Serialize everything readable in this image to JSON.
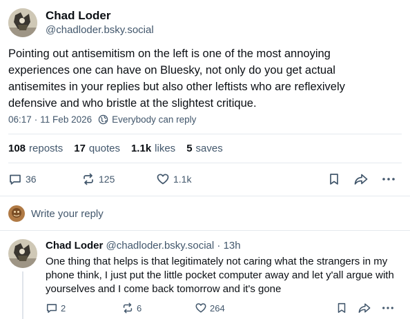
{
  "post": {
    "author_name": "Chad Loder",
    "author_handle": "@chadloder.bsky.social",
    "text": "Pointing out antisemitism on the left is one of the most annoying experiences one can have on Bluesky, not only do you get actual antisemites in your replies but also other leftists who are reflexively defensive and who bristle at the slightest critique.",
    "time": "06:17",
    "date": "11 Feb 2026",
    "separator": "·",
    "reply_setting": "Everybody can reply",
    "stats": {
      "reposts_count": "108",
      "reposts_label": "reposts",
      "quotes_count": "17",
      "quotes_label": "quotes",
      "likes_count": "1.1k",
      "likes_label": "likes",
      "saves_count": "5",
      "saves_label": "saves"
    },
    "actions": {
      "replies": "36",
      "reposts": "125",
      "likes": "1.1k"
    }
  },
  "composer": {
    "placeholder": "Write your reply"
  },
  "reply": {
    "author_name": "Chad Loder",
    "author_handle": "@chadloder.bsky.social",
    "separator": "·",
    "time": "13h",
    "text": "One thing that helps is that legitimately not caring what the strangers in my phone think, I just put the little pocket computer away and let y'all argue with yourselves and I come back tomorrow and it's gone",
    "actions": {
      "replies": "2",
      "reposts": "6",
      "likes": "264"
    }
  },
  "colors": {
    "text_primary": "#0b0f14",
    "text_secondary": "#42576c",
    "divider": "#e4e9ee"
  },
  "icons": {
    "reply": "speech-bubble-icon",
    "repost": "repost-arrows-icon",
    "like": "heart-icon",
    "bookmark": "bookmark-icon",
    "share": "share-arrow-icon",
    "more": "more-dots-icon",
    "reply_setting": "globe-icon"
  }
}
